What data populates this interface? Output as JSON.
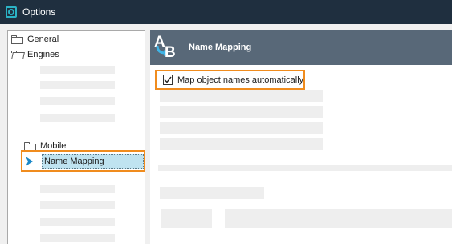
{
  "window": {
    "title": "Options",
    "icon": "gear-icon"
  },
  "tree": {
    "items": [
      {
        "label": "General",
        "icon": "folder-icon"
      },
      {
        "label": "Engines",
        "icon": "folder-open-icon"
      },
      {
        "label": "Mobile",
        "icon": "folder-icon"
      },
      {
        "label": "Name Mapping",
        "icon": "chevron-right-icon",
        "selected": true
      }
    ]
  },
  "panel": {
    "title": "Name Mapping",
    "icon": "ab-mapping-icon",
    "checkbox": {
      "label": "Map object names automatically",
      "checked": true
    }
  },
  "colors": {
    "titlebar": "#1f2f3f",
    "panel_header": "#586878",
    "highlight": "#f08c1e",
    "selection": "#bfe3f0",
    "accent": "#2bb3c6"
  }
}
